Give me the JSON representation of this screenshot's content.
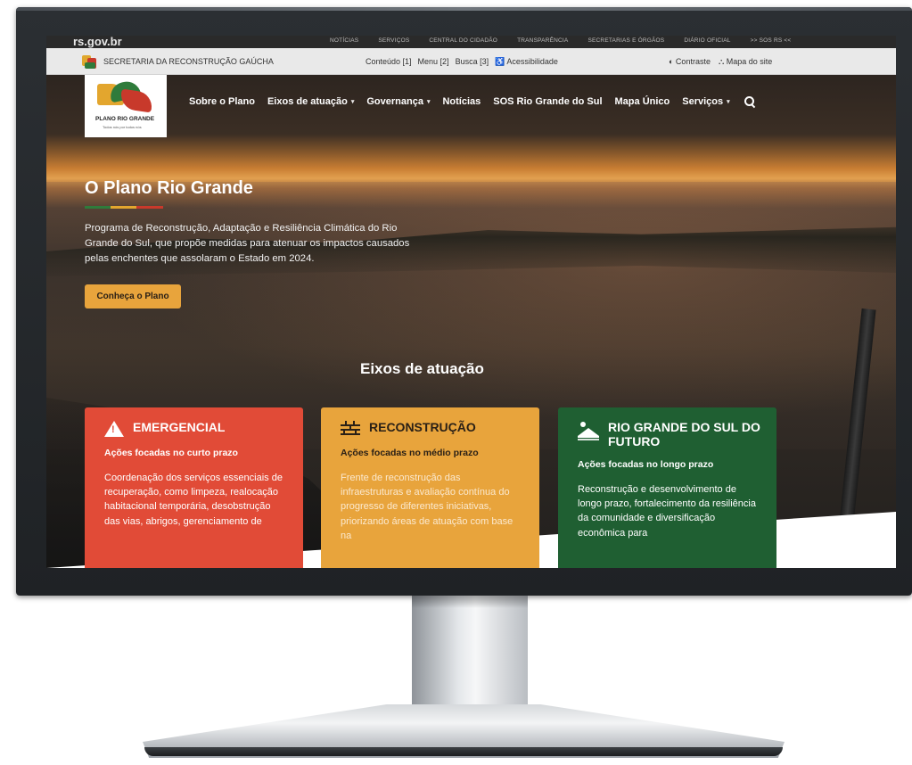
{
  "top_bar": {
    "brand": "rs.gov.br",
    "links": [
      "NOTÍCIAS",
      "SERVIÇOS",
      "CENTRAL DO CIDADÃO",
      "TRANSPARÊNCIA",
      "SECRETARIAS E ÓRGÃOS",
      "DIÁRIO OFICIAL",
      ">> SOS RS <<"
    ]
  },
  "secretaria_bar": {
    "name": "SECRETARIA DA RECONSTRUÇÃO GAÚCHA",
    "access_links": [
      "Conteúdo [1]",
      "Menu [2]",
      "Busca [3]",
      "♿ Acessibilidade"
    ],
    "contrast": "◐ Contraste",
    "sitemap": "⛬ Mapa do site"
  },
  "logo": {
    "line1": "PLANO RIO GRANDE",
    "tagline": "Todos nós por todos nós"
  },
  "nav": {
    "items": [
      {
        "label": "Sobre o Plano",
        "caret": ""
      },
      {
        "label": "Eixos de atuação",
        "caret": "▾"
      },
      {
        "label": "Governança",
        "caret": "▾"
      },
      {
        "label": "Notícias",
        "caret": ""
      },
      {
        "label": "SOS Rio Grande do Sul",
        "caret": ""
      },
      {
        "label": "Mapa Único",
        "caret": ""
      },
      {
        "label": "Serviços",
        "caret": "▾"
      }
    ]
  },
  "hero": {
    "title": "O Plano Rio Grande",
    "description": "Programa de Reconstrução, Adaptação e Resiliência Climática do Rio Grande do Sul, que propõe medidas para atenuar os impactos causados pelas enchentes que assolaram o Estado em 2024.",
    "cta": "Conheça o Plano"
  },
  "eixos": {
    "title": "Eixos de atuação",
    "cards": [
      {
        "title": "EMERGENCIAL",
        "subtitle": "Ações focadas no curto prazo",
        "text": "Coordenação dos serviços essenciais de recuperação, como limpeza, realocação habitacional temporária, desobstrução das vias, abrigos, gerenciamento de",
        "color": "#e14b37"
      },
      {
        "title": "RECONSTRUÇÃO",
        "subtitle": "Ações focadas no médio prazo",
        "text": "Frente de reconstrução das infraestruturas e avaliação contínua do progresso de diferentes iniciativas, priorizando áreas de atuação com base na",
        "color": "#e8a43c"
      },
      {
        "title": "RIO GRANDE DO SUL DO FUTURO",
        "subtitle": "Ações focadas no longo prazo",
        "text": "Reconstrução e desenvolvimento de longo prazo, fortalecimento da resiliência da comunidade e diversificação econômica para",
        "color": "#1f5f32"
      }
    ]
  }
}
